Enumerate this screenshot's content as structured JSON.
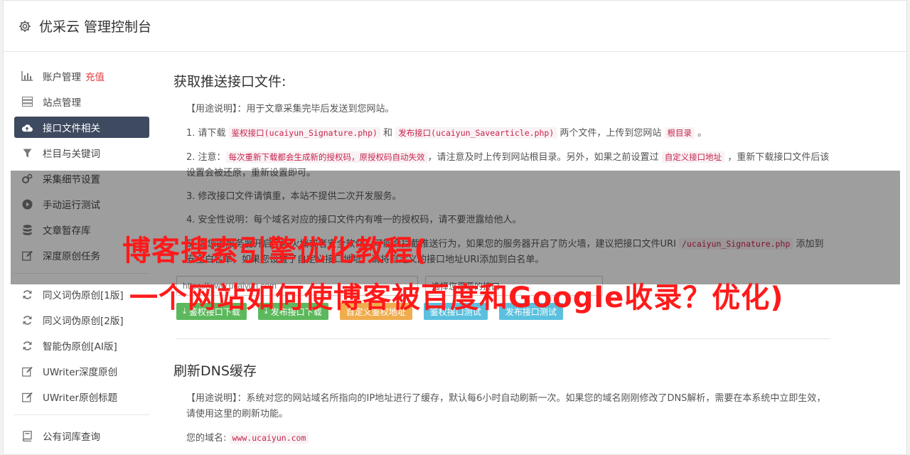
{
  "header": {
    "title": "优采云 管理控制台"
  },
  "sidebar": {
    "items": [
      {
        "label": "账户管理",
        "extra": "充值",
        "icon": "bar-chart-icon"
      },
      {
        "label": "站点管理",
        "icon": "server-icon"
      },
      {
        "label": "接口文件相关",
        "icon": "cloud-upload-icon",
        "active": true
      },
      {
        "label": "栏目与关键词",
        "icon": "filter-icon"
      },
      {
        "label": "采集细节设置",
        "icon": "cogs-icon"
      },
      {
        "label": "手动运行测试",
        "icon": "play-icon"
      },
      {
        "label": "文章暂存库",
        "icon": "database-icon"
      },
      {
        "label": "深度原创任务",
        "icon": "edit-icon"
      }
    ],
    "items2": [
      {
        "label": "同义词伪原创[1版]",
        "icon": "refresh-icon"
      },
      {
        "label": "同义词伪原创[2版]",
        "icon": "refresh-icon"
      },
      {
        "label": "智能伪原创[AI版]",
        "icon": "refresh-icon"
      },
      {
        "label": "UWriter深度原创",
        "icon": "edit-icon"
      },
      {
        "label": "UWriter原创标题",
        "icon": "edit-icon"
      }
    ],
    "items3": [
      {
        "label": "公有词库查询",
        "icon": "book-icon"
      }
    ]
  },
  "section1": {
    "title": "获取推送接口文件:",
    "usage": "【用途说明】：用于文章采集完毕后发送到您网站。",
    "p1": {
      "a": "1. 请下载 ",
      "c1": "鉴权接口(ucaiyun_Signature.php)",
      "b": " 和 ",
      "c2": "发布接口(ucaiyun_Savearticle.php)",
      "c": " 两个文件，上传到您网站 ",
      "c3": "根目录",
      "d": " 。"
    },
    "p2": {
      "a": "2. 注意：",
      "c1": "每次重新下载都会生成新的授权码，原授权码自动失效",
      "b": "，请注意及时上传到网站根目录。另外，如果之前设置过 ",
      "c2": "自定义接口地址",
      "c": " ，重新下载接口文件后该设置会被还原，重新设置即可。"
    },
    "p3": "3. 修改接口文件请慎重，本站不提供二次开发服务。",
    "p4": "4. 安全性说明：每个域名对应的接口文件内有唯一的授权码，请不要泄露给他人。",
    "p5": {
      "a": "5. 如您的服务器开启了防火墙或者安全软件，可能会拦截推送行为，如果您的服务器开启了防火墙，建议把接口文件URI ",
      "c1": "/ucaiyun_Signature.php",
      "b": " 添加到安全白名单，如果您设置了自定义接口地址，请将自定义的接口地址URI添加到白名单。"
    },
    "url_placeholder": "https://www.ucaiyun.com",
    "select_label": "选择您需要的接口",
    "buttons": {
      "b1": "鉴权接口下载",
      "b2": "发布接口下载",
      "b3": "自定义鉴权地址",
      "b4": "鉴权接口测试",
      "b5": "发布接口测试"
    }
  },
  "section2": {
    "title": "刷新DNS缓存",
    "usage": "【用途说明】：系统对您的网站域名所指向的IP地址进行了缓存，默认每6小时自动刷新一次。如果您的域名刚刚修改了DNS解析，需要在本系统中立即生效，请使用这里的刷新功能。",
    "domain_label": "您的域名:",
    "domain_value": "www.ucaiyun.com"
  },
  "overlay": {
    "line1": "博客搜索引擎优化教程(",
    "line2": "一个网站如何使博客被百度和Google收录？优化)"
  },
  "colors": {
    "active_bg": "#3d4a5f",
    "green": "#5cb85c",
    "orange": "#f0ad4e",
    "blue": "#5bc0de",
    "overlay_text": "#ff1a1a"
  }
}
